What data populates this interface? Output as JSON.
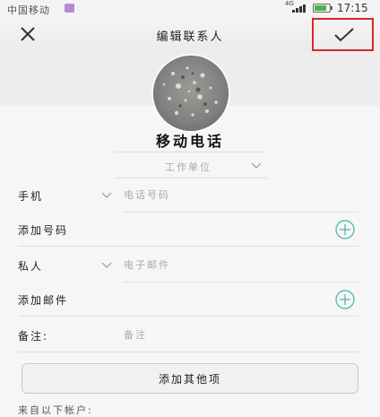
{
  "status_bar": {
    "carrier": "中国移动",
    "network": "4G",
    "time": "17:15"
  },
  "header": {
    "title": "编辑联系人",
    "close_icon": "close-icon",
    "save_icon": "checkmark-icon"
  },
  "contact": {
    "name": "移动电话",
    "company_placeholder": "工作单位"
  },
  "fields": {
    "phone": {
      "label": "手机",
      "placeholder": "电话号码"
    },
    "add_phone": {
      "label": "添加号码"
    },
    "email": {
      "label": "私人",
      "placeholder": "电子邮件"
    },
    "add_email": {
      "label": "添加邮件"
    },
    "note": {
      "label": "备注:",
      "placeholder": "备注"
    }
  },
  "add_other_label": "添加其他项",
  "from_accounts_label": "来自以下帐户:",
  "colors": {
    "accent": "#3fb5a5",
    "highlight": "#d5282a",
    "battery": "#46b64a"
  }
}
